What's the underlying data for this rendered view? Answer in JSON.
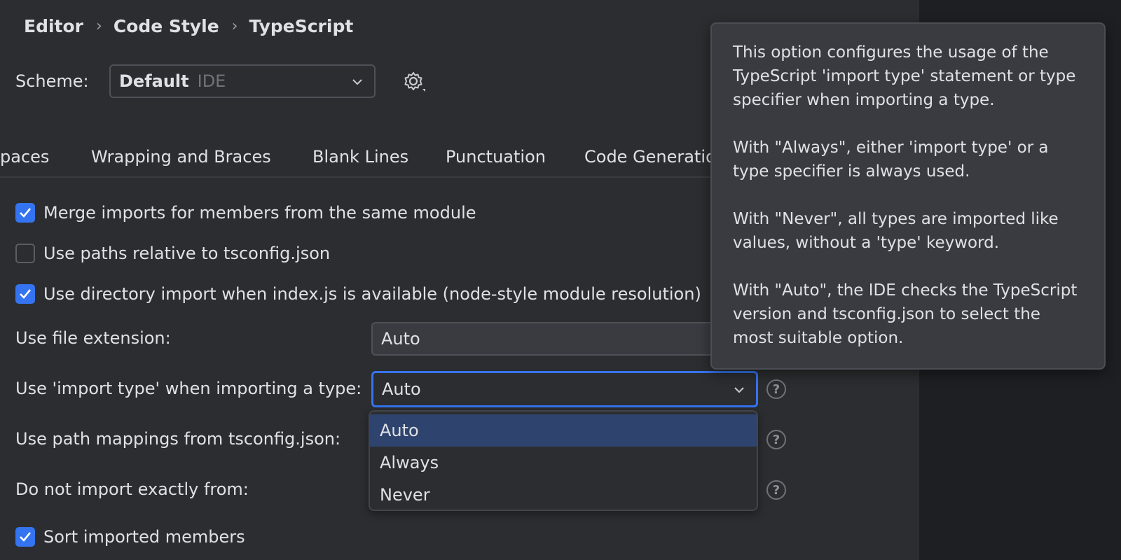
{
  "breadcrumb": [
    "Editor",
    "Code Style",
    "TypeScript"
  ],
  "scheme": {
    "label": "Scheme:",
    "value": "Default",
    "sub": "IDE"
  },
  "tabs": [
    "paces",
    "Wrapping and Braces",
    "Blank Lines",
    "Punctuation",
    "Code Generatio"
  ],
  "options": {
    "merge_imports": {
      "label": "Merge imports for members from the same module",
      "checked": true
    },
    "relative_paths": {
      "label": "Use paths relative to tsconfig.json",
      "checked": false
    },
    "directory_import": {
      "label": "Use directory import when index.js is available (node-style module resolution)",
      "checked": true
    },
    "sort_members": {
      "label": "Sort imported members",
      "checked": true
    }
  },
  "fields": {
    "file_extension": {
      "label": "Use file extension:",
      "value": "Auto"
    },
    "import_type": {
      "label": "Use 'import type' when importing a type:",
      "value": "Auto"
    },
    "path_mappings": {
      "label": "Use path mappings from tsconfig.json:"
    },
    "do_not_import": {
      "label": "Do not import exactly from:"
    }
  },
  "dropdown": {
    "options": [
      "Auto",
      "Always",
      "Never"
    ],
    "selected": "Auto"
  },
  "tooltip": {
    "p1": "This option configures the usage of the TypeScript 'import type' statement or type specifier when importing a type.",
    "p2": "With \"Always\", either 'import type' or a type specifier is always used.",
    "p3": "With \"Never\", all types are imported like values, without a 'type' keyword.",
    "p4": "With \"Auto\", the IDE checks the TypeScript version and tsconfig.json to select the most suitable option."
  },
  "help_glyph": "?",
  "colors": {
    "accent": "#3574f0",
    "selection": "#2e436e",
    "background": "#2b2d30",
    "tooltip": "#393b40"
  }
}
